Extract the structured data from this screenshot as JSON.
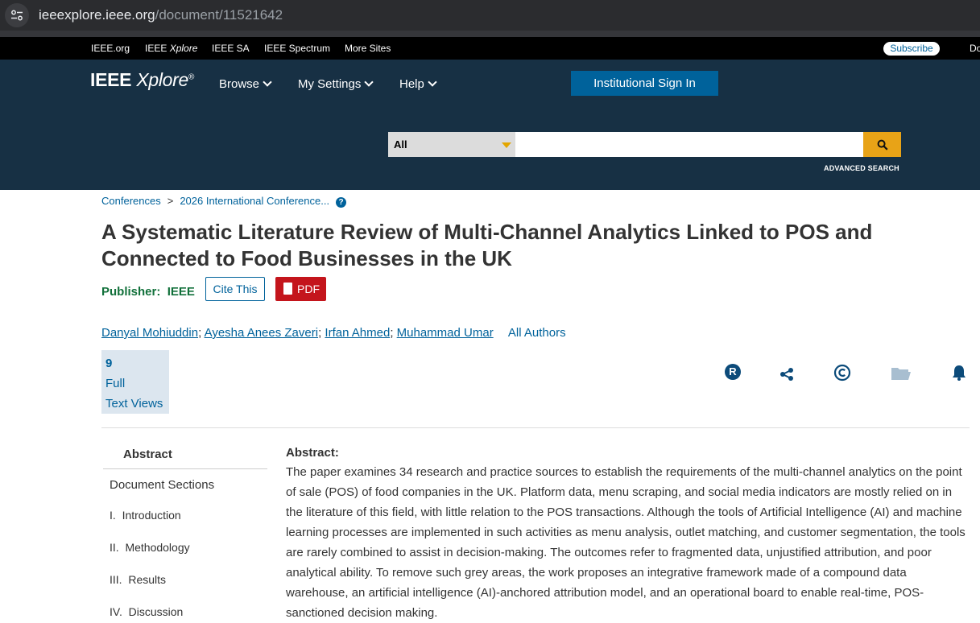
{
  "browser": {
    "url_host": "ieeexplore.ieee.org",
    "url_path": "/document/11521642"
  },
  "metabar": {
    "links": [
      "IEEE.org",
      "IEEE Xplore",
      "IEEE SA",
      "IEEE Spectrum",
      "More Sites"
    ],
    "subscribe": "Subscribe",
    "cut_link": "Do"
  },
  "header": {
    "logo_bold": "IEEE",
    "logo_italic": "Xplore",
    "logo_reg": "®",
    "nav": [
      "Browse",
      "My Settings",
      "Help"
    ],
    "signin": "Institutional Sign In",
    "search_scope": "All",
    "search_placeholder": "",
    "advanced": "ADVANCED SEARCH"
  },
  "breadcrumb": [
    "Conferences",
    "2026 International Conference..."
  ],
  "breadcrumb_separator": ">",
  "title": "A Systematic Literature Review of Multi-Channel Analytics Linked to POS and Connected to Food Businesses in the UK",
  "publisher_label": "Publisher:",
  "publisher": "IEEE",
  "cite": "Cite This",
  "pdf": "PDF",
  "authors": [
    "Danyal Mohiuddin",
    "Ayesha Anees Zaveri",
    "Irfan Ahmed",
    "Muhammad Umar"
  ],
  "all_authors": "All Authors",
  "views": {
    "count": "9",
    "line1": "Full",
    "line2": "Text Views"
  },
  "action_icons": [
    "rights-icon",
    "share-icon",
    "copyright-icon",
    "folder-icon",
    "alert-bell-icon"
  ],
  "sidebar": {
    "abstract": "Abstract",
    "document_sections": "Document Sections",
    "sections": [
      {
        "num": "I.",
        "label": "Introduction"
      },
      {
        "num": "II.",
        "label": "Methodology"
      },
      {
        "num": "III.",
        "label": "Results"
      },
      {
        "num": "IV.",
        "label": "Discussion"
      }
    ]
  },
  "abstract": {
    "heading": "Abstract:",
    "text": "The paper examines 34 research and practice sources to establish the requirements of the multi-channel analytics on the point of sale (POS) of food companies in the UK. Platform data, menu scraping, and social media indicators are mostly relied on in the literature of this field, with little relation to the POS transactions. Although the tools of Artificial Intelligence (AI) and machine learning processes are implemented in such activities as menu analysis, outlet matching, and customer segmentation, the tools are rarely combined to assist in decision-making. The outcomes refer to fragmented data, unjustified attribution, and poor analytical ability. To remove such grey areas, the work proposes an integrative framework made of a compound data warehouse, an artificial intelligence (AI)-anchored attribution model, and an operational board to enable real-time, POS-sanctioned decision making."
  },
  "colors": {
    "header_bg": "#173044",
    "link": "#00629b",
    "publisher": "#11703a",
    "pdf": "#c4151c",
    "search_button": "#e8a317"
  }
}
